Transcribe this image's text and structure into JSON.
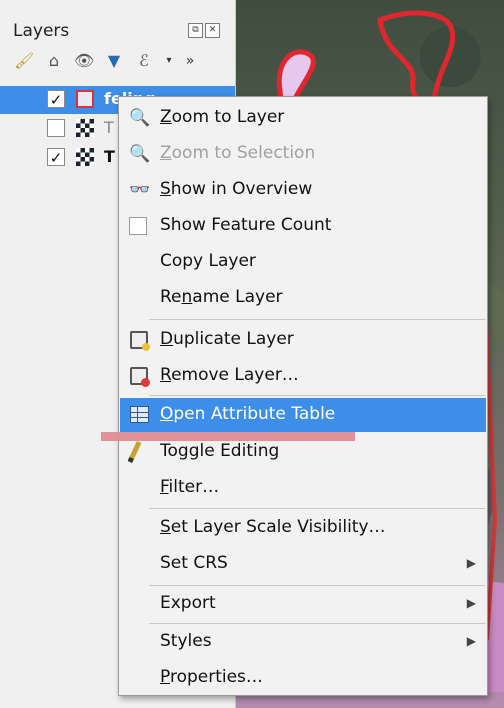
{
  "panel": {
    "title": "Layers",
    "header_buttons": [
      "undock-icon",
      "close-icon"
    ],
    "toolbar": [
      {
        "name": "style-manager-icon",
        "glyph": "🖌"
      },
      {
        "name": "add-group-icon",
        "glyph": "⌂"
      },
      {
        "name": "visibility-eye-icon",
        "glyph": "👁"
      },
      {
        "name": "filter-legend-icon",
        "glyph": "▼"
      },
      {
        "name": "expression-filter-icon",
        "glyph": "ℰ"
      },
      {
        "name": "dropdown-arrow-icon",
        "glyph": "▾"
      },
      {
        "name": "more-tools-icon",
        "glyph": "»"
      }
    ]
  },
  "layers": [
    {
      "label": "feling",
      "checked": true,
      "type": "polygon",
      "selected": true
    },
    {
      "label": "T",
      "checked": false,
      "type": "raster",
      "selected": false
    },
    {
      "label": "T",
      "checked": true,
      "type": "raster",
      "selected": false
    }
  ],
  "menu": {
    "items": [
      {
        "pre": "",
        "ul": "Z",
        "post": "oom to Layer",
        "icon": "zoom-icon",
        "glyph": "🔍",
        "disabled": false
      },
      {
        "pre": "",
        "ul": "Z",
        "post": "oom to Selection",
        "icon": "zoom-selection-icon",
        "glyph": "🔍",
        "disabled": true
      },
      {
        "pre": "",
        "ul": "S",
        "post": "how in Overview",
        "icon": "overview-glasses-icon",
        "glyph": "👓",
        "disabled": false
      },
      {
        "pre": "Show Feature Count",
        "ul": "",
        "post": "",
        "icon": "feature-count-checkbox-icon",
        "glyph": "",
        "disabled": false
      },
      {
        "pre": "Copy Layer",
        "ul": "",
        "post": "",
        "icon": "",
        "glyph": "",
        "disabled": false
      },
      {
        "pre": "Re",
        "ul": "n",
        "post": "ame Layer",
        "icon": "",
        "glyph": "",
        "disabled": false
      },
      {
        "pre": "",
        "ul": "D",
        "post": "uplicate Layer",
        "icon": "duplicate-layer-icon",
        "glyph": "",
        "disabled": false
      },
      {
        "pre": "",
        "ul": "R",
        "post": "emove Layer…",
        "icon": "remove-layer-icon",
        "glyph": "",
        "disabled": false
      },
      {
        "pre": "",
        "ul": "O",
        "post": "pen Attribute Table",
        "icon": "attribute-table-icon",
        "glyph": "",
        "disabled": false,
        "highlight": true
      },
      {
        "pre": "Toggle Editing",
        "ul": "",
        "post": "",
        "icon": "pencil-icon",
        "glyph": "",
        "disabled": false
      },
      {
        "pre": "",
        "ul": "F",
        "post": "ilter…",
        "icon": "",
        "glyph": "",
        "disabled": false
      },
      {
        "pre": "",
        "ul": "S",
        "post": "et Layer Scale Visibility…",
        "icon": "",
        "glyph": "",
        "disabled": false
      },
      {
        "pre": "Set CRS",
        "ul": "",
        "post": "",
        "icon": "",
        "glyph": "",
        "disabled": false,
        "submenu": true
      },
      {
        "pre": "Export",
        "ul": "",
        "post": "",
        "icon": "",
        "glyph": "",
        "disabled": false,
        "submenu": true
      },
      {
        "pre": "Styles",
        "ul": "",
        "post": "",
        "icon": "",
        "glyph": "",
        "disabled": false,
        "submenu": true
      },
      {
        "pre": "",
        "ul": "P",
        "post": "roperties…",
        "icon": "",
        "glyph": "",
        "disabled": false
      }
    ],
    "submenu_glyph": "▶"
  },
  "colors": {
    "selection_blue": "#3d8ee8",
    "annotation_red": "#e08a8e",
    "polygon_outline": "#d9333c"
  }
}
